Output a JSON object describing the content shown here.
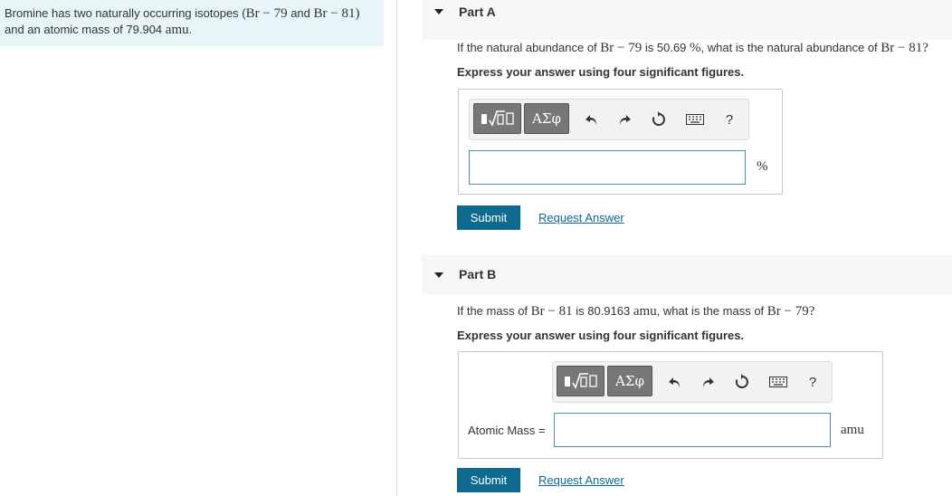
{
  "intro": {
    "text_1": "Bromine has two naturally occurring isotopes (",
    "math_1": "Br − 79",
    "text_2": " and ",
    "math_2": "Br − 81",
    "text_3": ")",
    "text_4": "and an atomic mass of 79.904 ",
    "math_3": "amu",
    "text_5": "."
  },
  "partA": {
    "title": "Part A",
    "q_text_1": "If the natural abundance of ",
    "q_math_1": "Br − 79",
    "q_text_2": " is 50.69 ",
    "q_math_2": "%",
    "q_text_3": ", what is the natural abundance of ",
    "q_math_3": "Br − 81",
    "q_text_4": "?",
    "instruction": "Express your answer using four significant figures.",
    "toolbar": {
      "greek": "ΑΣφ",
      "help": "?"
    },
    "input_value": "",
    "unit": "%",
    "submit_label": "Submit",
    "request_label": "Request Answer"
  },
  "partB": {
    "title": "Part B",
    "q_text_1": "If the mass of ",
    "q_math_1": "Br − 81",
    "q_text_2": " is 80.9163 ",
    "q_math_2": "amu",
    "q_text_3": ", what is the mass of ",
    "q_math_3": "Br − 79",
    "q_text_4": "?",
    "instruction": "Express your answer using four significant figures.",
    "toolbar": {
      "greek": "ΑΣφ",
      "help": "?"
    },
    "field_label": "Atomic Mass =",
    "input_value": "",
    "unit": "amu",
    "submit_label": "Submit",
    "request_label": "Request Answer"
  }
}
